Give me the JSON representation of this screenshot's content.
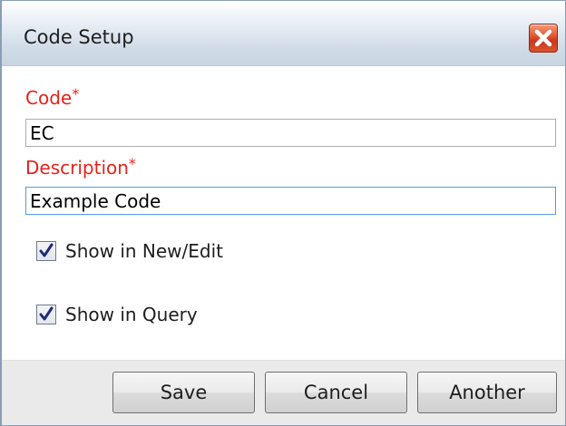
{
  "window": {
    "title": "Code Setup"
  },
  "form": {
    "code_label": "Code",
    "description_label": "Description",
    "required_marker": "*",
    "code_value": "EC",
    "description_value": "Example Code"
  },
  "options": {
    "show_new_edit_label": "Show in New/Edit",
    "show_new_edit_checked": true,
    "show_query_label": "Show in Query",
    "show_query_checked": true
  },
  "buttons": {
    "save_label": "Save",
    "cancel_label": "Cancel",
    "another_label": "Another"
  },
  "icons": {
    "close": "close-icon",
    "check": "checkmark-icon"
  },
  "colors": {
    "required_label": "#e8211a",
    "close_button": "#d9542f",
    "focused_border": "#569de5",
    "checkmark": "#1f2c7a"
  }
}
